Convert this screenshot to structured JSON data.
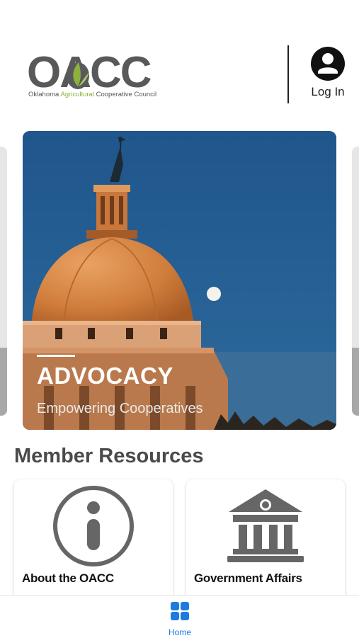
{
  "header": {
    "logo_text": "OACC",
    "logo_subtitle_pre": "Oklahoma",
    "logo_subtitle_ag": "Agricultural",
    "logo_subtitle_post": "Cooperative Council",
    "login_label": "Log In"
  },
  "carousel": {
    "slide_title": "ADVOCACY",
    "slide_subtitle": "Empowering Cooperatives"
  },
  "resources": {
    "title": "Member Resources",
    "cards": [
      {
        "label": "About the OACC",
        "icon": "info-icon"
      },
      {
        "label": "Government Affairs",
        "icon": "government-building-icon"
      }
    ]
  },
  "tabbar": {
    "items": [
      {
        "label": "Home",
        "icon": "home-grid-icon",
        "active": true
      }
    ]
  },
  "colors": {
    "accent": "#1f7ae0",
    "logo_gray": "#58595b",
    "logo_green": "#8cb13d",
    "sky": "#245b8f",
    "dome": "#d4803f"
  }
}
